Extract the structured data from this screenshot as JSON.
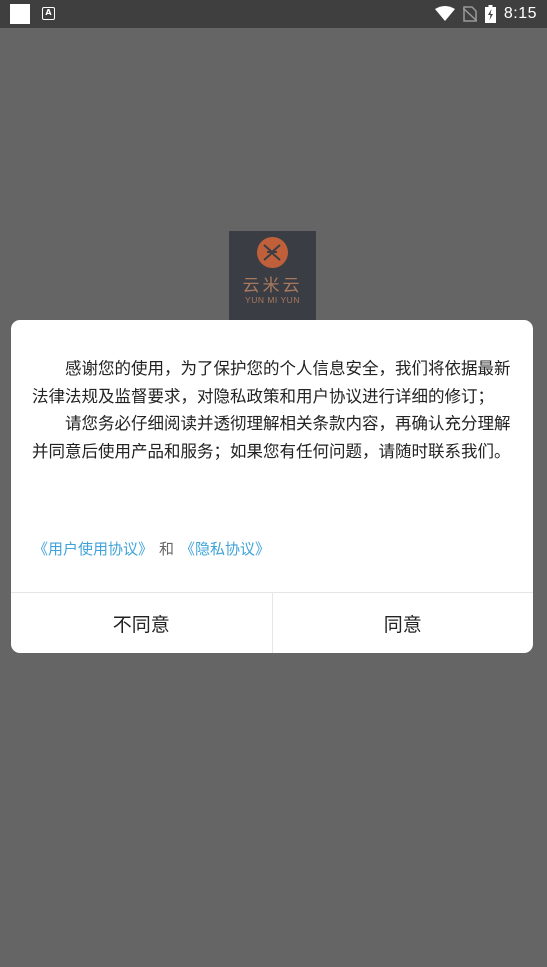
{
  "status_bar": {
    "time": "8:15",
    "icons": [
      "app-square-icon",
      "font-a-icon",
      "wifi-icon",
      "no-sim-icon",
      "battery-charging-icon"
    ]
  },
  "app": {
    "logo_cn": "云米云",
    "logo_en": "YUN MI YUN"
  },
  "dialog": {
    "paragraphs": [
      "感谢您的使用，为了保护您的个人信息安全，我们将依据最新法律法规及监督要求，对隐私政策和用户协议进行详细的修订；",
      "请您务必仔细阅读并透彻理解相关条款内容，再确认充分理解并同意后使用产品和服务；如果您有任何问题，请随时联系我们。"
    ],
    "user_agreement_link": "《用户使用协议》",
    "and_text": "和",
    "privacy_link": "《隐私协议》",
    "disagree_label": "不同意",
    "agree_label": "同意"
  },
  "colors": {
    "link": "#3fa3d9",
    "overlay": "#656565",
    "status_bar": "#3f3f3f"
  }
}
